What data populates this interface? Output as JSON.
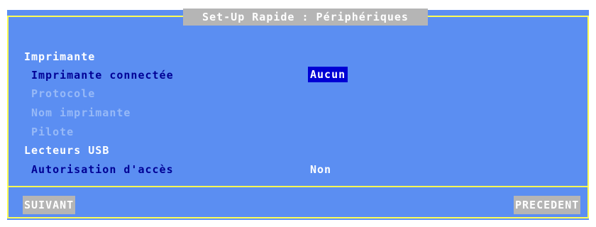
{
  "title": "Set-Up Rapide : Périphériques",
  "sections": {
    "printer": {
      "heading": "Imprimante",
      "connected_label": "Imprimante connectée",
      "connected_value": "Aucun",
      "protocol_label": "Protocole",
      "printer_name_label": "Nom imprimante",
      "driver_label": "Pilote"
    },
    "usb": {
      "heading": "Lecteurs USB",
      "access_label": "Autorisation d'accès",
      "access_value": "Non"
    }
  },
  "buttons": {
    "next": "SUIVANT",
    "previous": "PRECEDENT"
  },
  "colors": {
    "background": "#5b8ef2",
    "frame": "#ffff54",
    "selection": "#0000d4",
    "label": "#000095",
    "disabled": "#97b9f7",
    "title_bar": "#b5b5b5"
  }
}
